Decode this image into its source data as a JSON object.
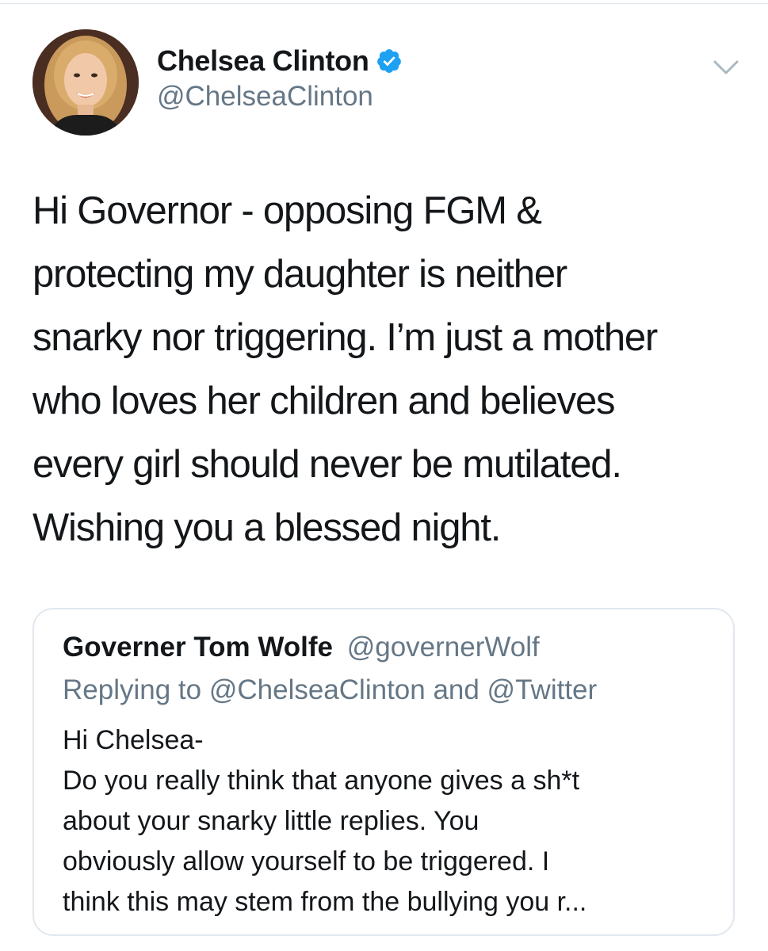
{
  "colors": {
    "text": "#14171a",
    "secondary": "#657786",
    "verified_blue": "#1da1f2",
    "border": "#e1e8ed"
  },
  "tweet": {
    "display_name": "Chelsea Clinton",
    "handle": "@ChelseaClinton",
    "verified_icon": "verified-badge-icon",
    "menu_icon": "chevron-down-icon",
    "text_lines": [
      "Hi Governor - opposing FGM &",
      "protecting my daughter is neither",
      "snarky nor triggering. I’m just a mother",
      "who loves her children and believes",
      "every girl should never be mutilated.",
      "Wishing you a blessed night."
    ]
  },
  "quoted_tweet": {
    "display_name": "Governer Tom Wolfe",
    "handle": "@governerWolf",
    "replying_to": "Replying to @ChelseaClinton and @Twitter",
    "body_lines": [
      "Hi Chelsea-",
      "Do you really think that anyone gives a sh*t",
      "about your snarky little replies. You",
      "obviously allow yourself to be triggered. I",
      "think this may stem from the bullying you r..."
    ]
  }
}
